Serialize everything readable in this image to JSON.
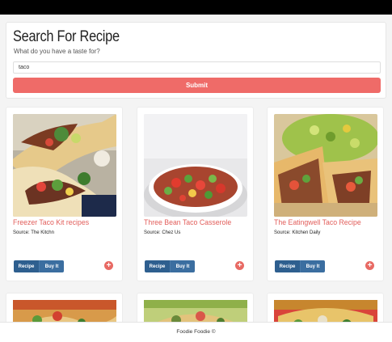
{
  "search": {
    "title": "Search For Recipe",
    "subtitle": "What do you have a taste for?",
    "value": "taco",
    "submit_label": "Submit"
  },
  "recipes": [
    {
      "title": "Freezer Taco Kit recipes",
      "source": "Source: The Kitchn",
      "recipe_label": "Recipe",
      "buy_label": "Buy It",
      "add_icon": "plus-circle-icon"
    },
    {
      "title": "Three Bean Taco Casserole",
      "source": "Source: Chez Us",
      "recipe_label": "Recipe",
      "buy_label": "Buy It",
      "add_icon": "plus-circle-icon"
    },
    {
      "title": "The Eatingwell Taco Recipe",
      "source": "Source: Kitchen Daily",
      "recipe_label": "Recipe",
      "buy_label": "Buy It",
      "add_icon": "plus-circle-icon"
    }
  ],
  "footer": {
    "text": "Foodie Foodie ©"
  },
  "colors": {
    "accent": "#ef6b68",
    "title": "#e25d5a",
    "button": "#2e5f8f"
  }
}
